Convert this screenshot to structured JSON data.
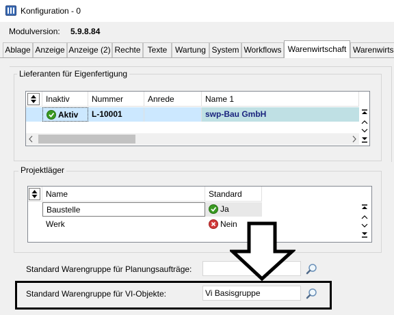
{
  "window": {
    "title": "Konfiguration - 0"
  },
  "module_version": {
    "label": "Modulversion:",
    "value": "5.9.8.84"
  },
  "tabs": [
    {
      "label": "Ablage"
    },
    {
      "label": "Anzeige"
    },
    {
      "label": "Anzeige (2)"
    },
    {
      "label": "Rechte"
    },
    {
      "label": "Texte"
    },
    {
      "label": "Wartung"
    },
    {
      "label": "System"
    },
    {
      "label": "Workflows"
    },
    {
      "label": "Warenwirtschaft"
    },
    {
      "label": "Warenwirtsch"
    }
  ],
  "active_tab": "Warenwirtschaft",
  "lieferanten": {
    "title": "Lieferanten für Eigenfertigung",
    "columns": [
      "Inaktiv",
      "Nummer",
      "Anrede",
      "Name 1"
    ],
    "rows": [
      {
        "inaktiv": "Aktiv",
        "nummer": "L-10001",
        "anrede": "",
        "name1": "swp-Bau GmbH"
      }
    ]
  },
  "projektlaeger": {
    "title": "Projektläger",
    "columns": [
      "Name",
      "Standard"
    ],
    "rows": [
      {
        "name": "Baustelle",
        "standard": "Ja"
      },
      {
        "name": "Werk",
        "standard": "Nein"
      }
    ]
  },
  "fields": {
    "planungsauftraege": {
      "label": "Standard Warengruppe für Planungsaufträge:",
      "value": ""
    },
    "vi_objekte": {
      "label": "Standard Warengruppe für VI-Objekte:",
      "value": "Vi Basisgruppe"
    }
  },
  "colors": {
    "selection": "#cce8ff",
    "name_highlight": "#bfe0e4",
    "name_text": "#1a237e",
    "annotation": "#000000"
  },
  "icons": [
    "app-icon",
    "sort-icon",
    "check-icon",
    "x-icon",
    "search-icon",
    "scroll-end-up-icon",
    "scroll-up-icon",
    "scroll-down-icon",
    "scroll-end-down-icon",
    "scroll-left-icon",
    "scroll-right-icon",
    "arrow-down-annotation"
  ]
}
